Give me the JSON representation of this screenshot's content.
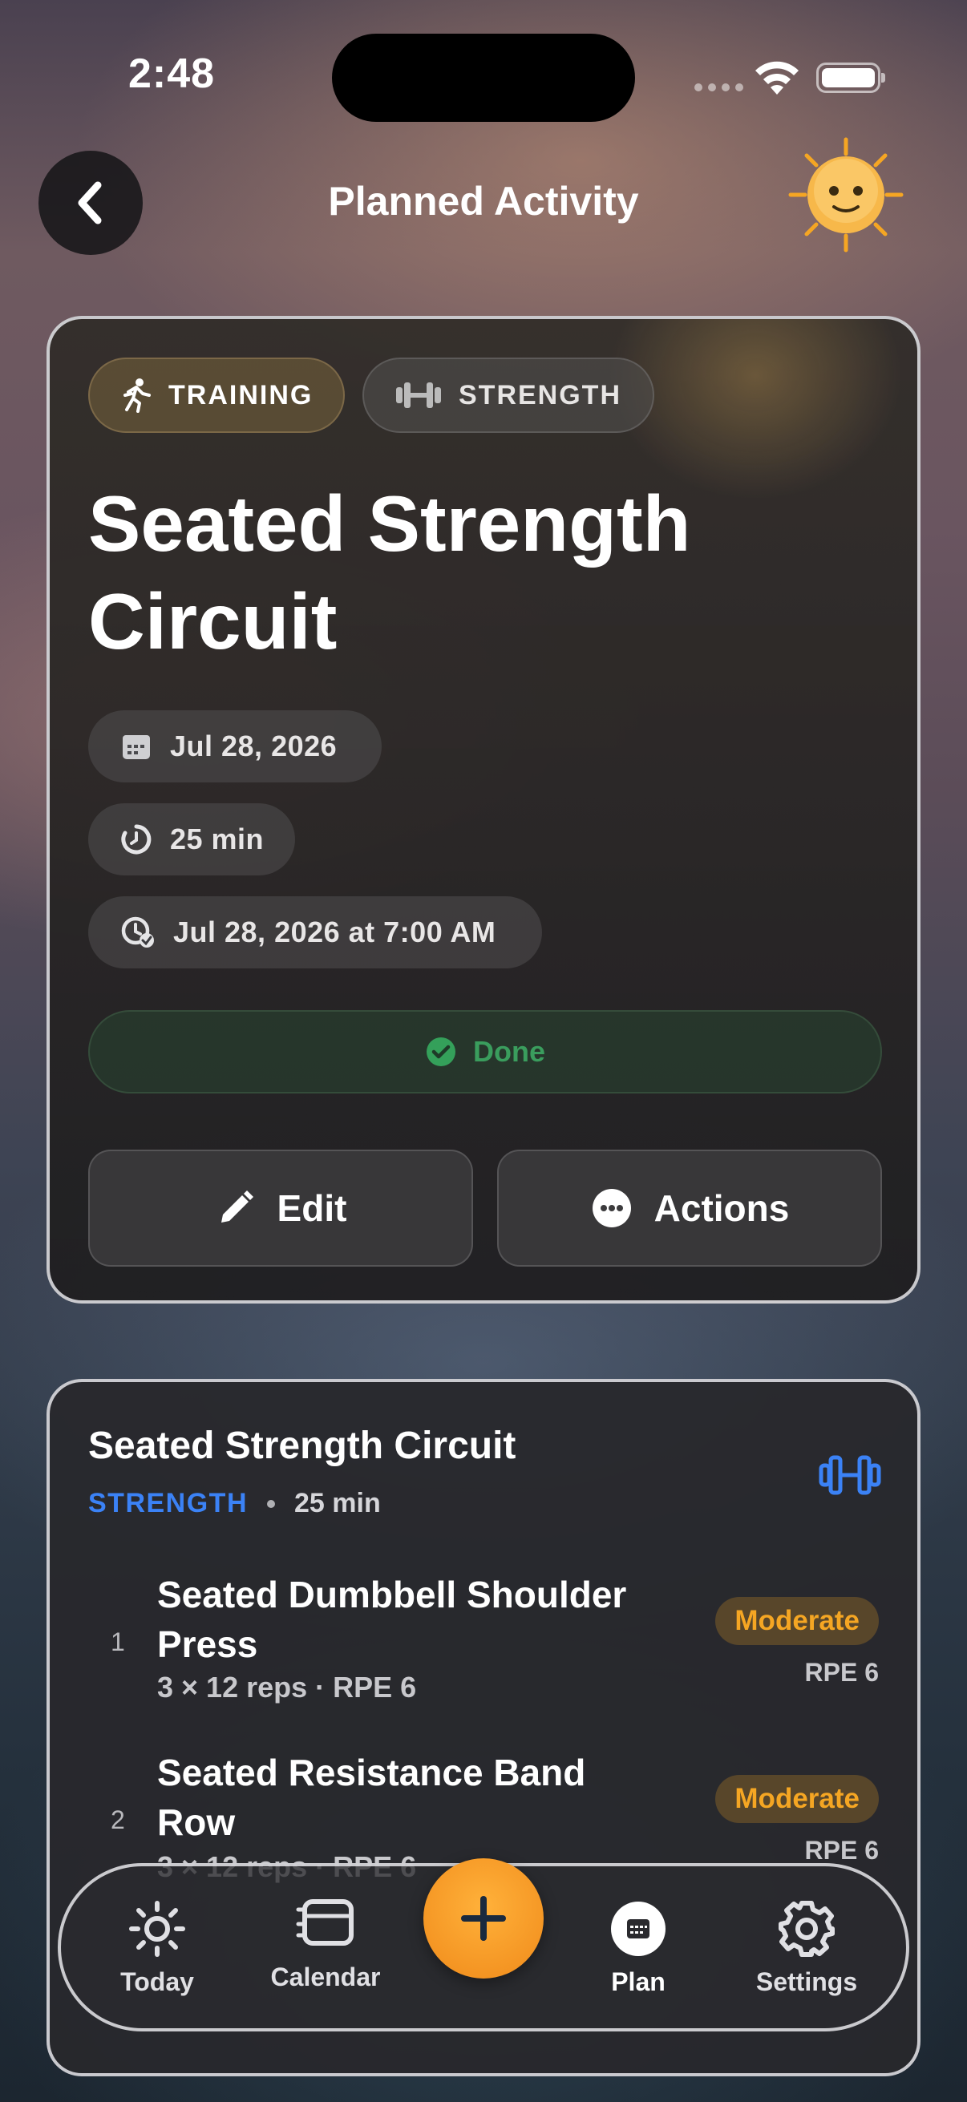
{
  "status_bar": {
    "time": "2:48"
  },
  "nav": {
    "title": "Planned Activity"
  },
  "activity": {
    "category_chip": "TRAINING",
    "type_chip": "STRENGTH",
    "title": "Seated Strength Circuit",
    "date": "Jul 28, 2026",
    "duration": "25 min",
    "scheduled": "Jul 28, 2026 at 7:00 AM",
    "status": "Done",
    "status_color": "#3a9d5d",
    "edit_label": "Edit",
    "actions_label": "Actions"
  },
  "workout": {
    "title": "Seated Strength Circuit",
    "type": "STRENGTH",
    "type_color": "#3b82f6",
    "duration": "25 min",
    "exercises": [
      {
        "index": "1",
        "name": "Seated Dumbbell Shoulder Press",
        "detail": "3 × 12 reps · RPE 6",
        "intensity": "Moderate",
        "rpe": "RPE 6"
      },
      {
        "index": "2",
        "name": "Seated Resistance Band Row",
        "detail": "3 × 12 reps · RPE 6",
        "intensity": "Moderate",
        "rpe": "RPE 6"
      }
    ]
  },
  "tab_bar": {
    "today": "Today",
    "calendar": "Calendar",
    "plan": "Plan",
    "settings": "Settings",
    "accent": "#f5a623"
  }
}
